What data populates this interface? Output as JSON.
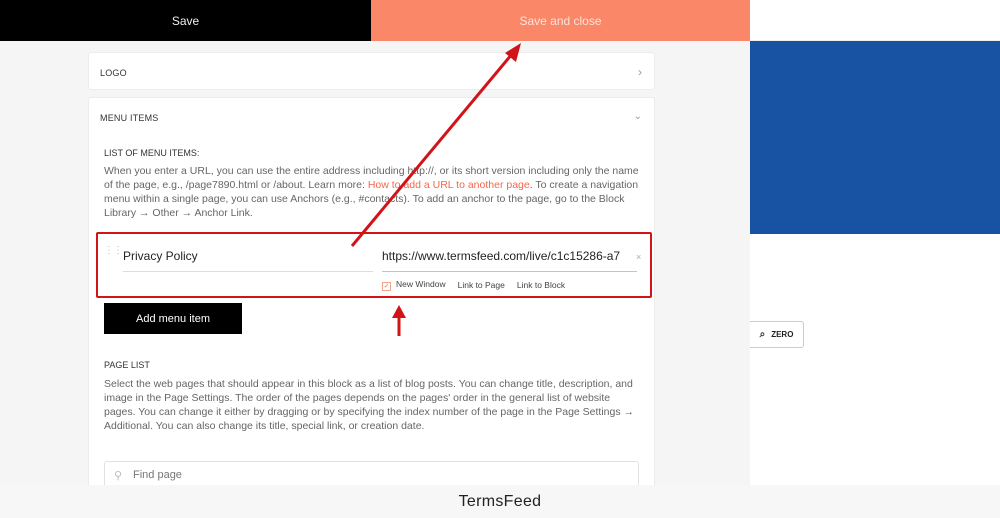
{
  "topbar": {
    "save_label": "Save",
    "save_close_label": "Save and close",
    "collapse_glyph": "‹"
  },
  "logo_section": {
    "title": "LOGO"
  },
  "menu_section": {
    "title": "MENU ITEMS",
    "list_label": "LIST OF MENU ITEMS:",
    "description_before_link": "When you enter a URL, you can use the entire address including http://, or its short version including only the name of the page, e.g., /page7890.html or /about. Learn more: ",
    "description_link": "How to add a URL to another page",
    "description_after_link": ". To create a navigation menu within a single page, you can use Anchors (e.g., #contacts). To add an anchor to the page, go to the Block Library → Other → Anchor Link.",
    "items": [
      {
        "title": "Privacy Policy",
        "url": "https://www.termsfeed.com/live/c1c15286-a7",
        "new_window_label": "New Window",
        "new_window_checked": true,
        "link_to_page_label": "Link to Page",
        "link_to_block_label": "Link to Block"
      }
    ],
    "add_item_label": "Add menu item"
  },
  "page_list": {
    "title": "PAGE LIST",
    "description": "Select the web pages that should appear in this block as a list of blog posts. You can change title, description, and image in the Page Settings. The order of the pages depends on the pages' order in the general list of website pages. You can change it either by dragging or by specifying the index number of the page in the Page Settings → Additional. You can also change its title, special link, or creation date.",
    "search_placeholder": "Find page"
  },
  "preview": {
    "zero_label": "ZERO"
  },
  "footer": {
    "brand": "TermsFeed"
  },
  "colors": {
    "accent": "#fa8768",
    "highlight_red": "#d01418",
    "preview_blue": "#1752a3"
  },
  "icons": [
    "chevron-right-icon",
    "chevron-down-icon",
    "chevron-left-icon",
    "drag-handle-icon",
    "search-icon",
    "zero-block-icon",
    "clear-icon"
  ]
}
